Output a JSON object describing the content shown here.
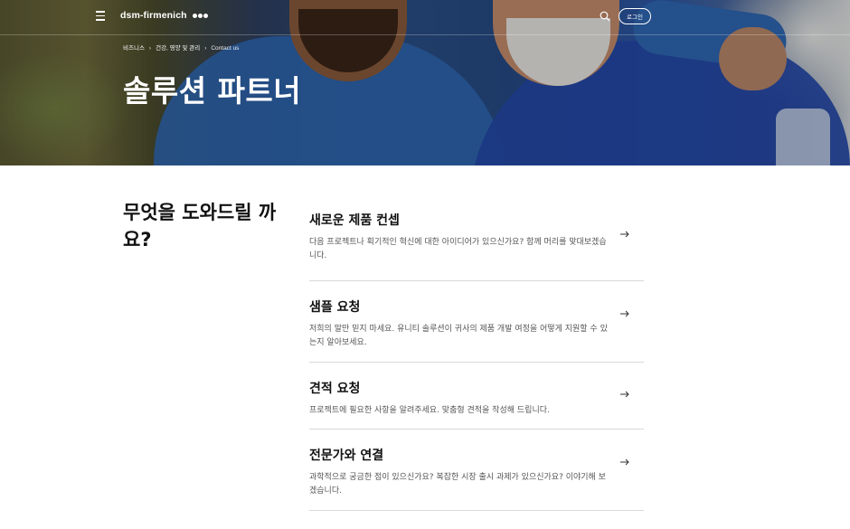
{
  "header": {
    "logo_text": "dsm-firmenich",
    "login_label": "로그인"
  },
  "icons": {
    "menu": "hamburger-menu-icon",
    "search": "search-icon",
    "arrow": "arrow-right-icon",
    "breadcrumb_separator": "chevron-right-icon"
  },
  "breadcrumb": {
    "items": [
      "비즈니스",
      "건강, 영양 및 관리",
      "Contact us"
    ]
  },
  "hero": {
    "title": "솔루션 파트너"
  },
  "help": {
    "heading": "무엇을 도와드릴 까요?"
  },
  "options": [
    {
      "title": "새로운 제품 컨셉",
      "description": "다음 프로젝트나 획기적인 혁신에 대한 아이디어가 있으신가요? 함께 머리를 맞대보겠습니다."
    },
    {
      "title": "샘플 요청",
      "description": "저희의 말만 믿지 마세요. 유니티 솔루션이 귀사의 제품 개발 여정을 어떻게 지원할 수 있는지 알아보세요."
    },
    {
      "title": "견적 요청",
      "description": "프로젝트에 필요한 사항을 알려주세요. 맞춤형 견적을 작성해 드립니다."
    },
    {
      "title": "전문가와 연결",
      "description": "과학적으로 궁금한 점이 있으신가요? 복잡한 시장 출시 과제가 있으신가요? 이야기해 보겠습니다."
    }
  ],
  "colors": {
    "hero_text": "#ffffff",
    "body_text": "#111111",
    "secondary_text": "#555555",
    "divider": "#d9d9d9"
  }
}
